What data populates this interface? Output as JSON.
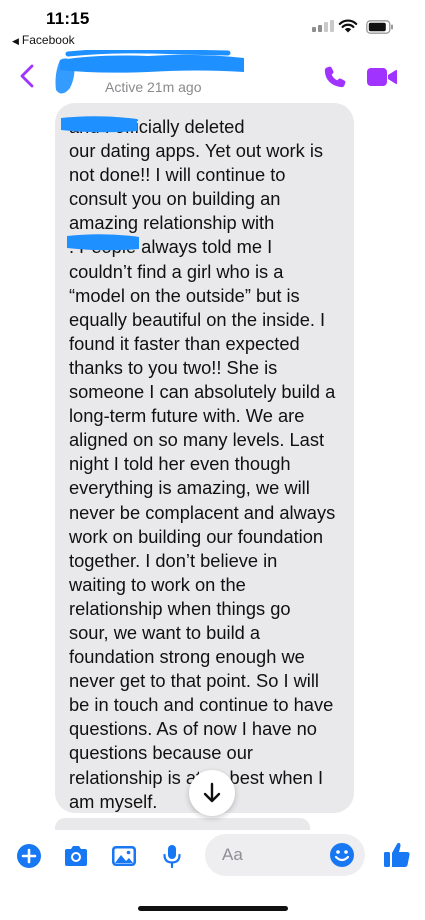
{
  "status_bar": {
    "time": "11:15",
    "back_app_label": "Facebook",
    "back_arrow": "◀"
  },
  "header": {
    "active_status": "Active 21m ago",
    "accent_color": "#a033ff",
    "redaction_color": "#1e90ff"
  },
  "message": {
    "text": "          and I officially deleted\nour dating apps. Yet out work is\nnot done!! I will continue to\nconsult you on building an\namazing relationship with\n              . People always told me I\ncouldn’t find a girl who is a\n“model on the outside” but is\nequally beautiful on the inside. I\nfound it faster than expected\nthanks to you two!! She is\nsomeone I can absolutely build a\nlong-term future with. We are\naligned on so many levels. Last\nnight I told her even though\neverything is amazing, we will\nnever be complacent and always\nwork on building our foundation\ntogether. I don’t believe in\nwaiting to work on the\nrelationship when things go\nsour, we want to build a\nfoundation strong enough we\nnever get to that point. So I will\nbe in touch and continue to have\nquestions. As of now I have no\nquestions because our\nrelationship is at its best when I\nam myself."
  },
  "composer": {
    "placeholder": "Aa",
    "icons": [
      "plus-icon",
      "camera-icon",
      "photo-icon",
      "microphone-icon",
      "emoji-icon",
      "thumbs-up-icon"
    ]
  }
}
